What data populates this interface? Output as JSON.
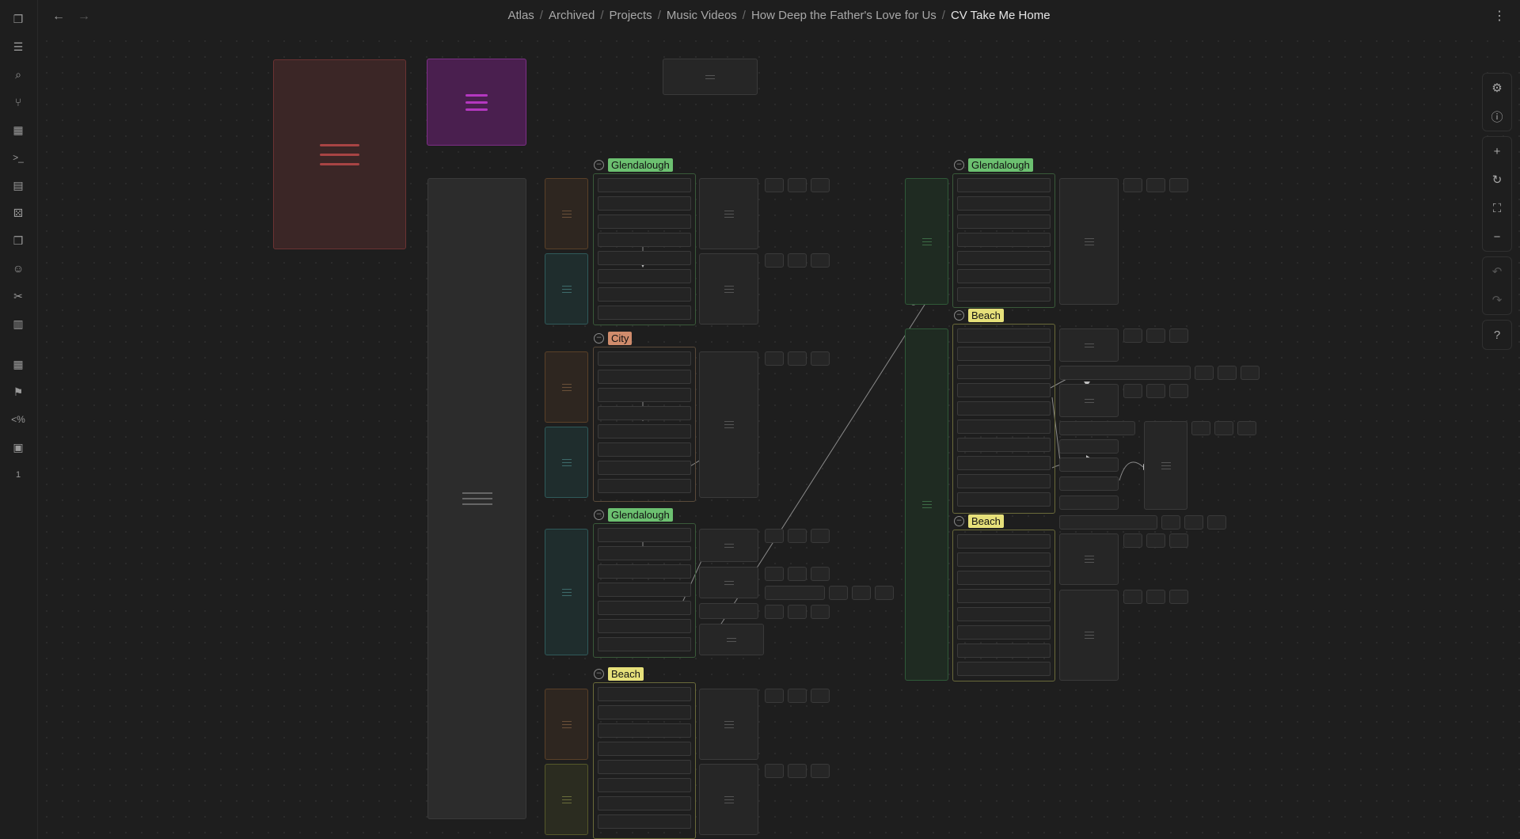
{
  "app": {
    "breadcrumb": [
      "Atlas",
      "Archived",
      "Projects",
      "Music Videos",
      "How Deep the Father's Love for Us",
      "CV Take Me Home"
    ],
    "separator": "/",
    "nav": {
      "back_icon": "arrow-left-icon",
      "forward_icon": "arrow-right-icon"
    },
    "more_icon": "more-vertical-icon"
  },
  "ribbon": {
    "icons": [
      "files-icon",
      "list-icon",
      "search-file-icon",
      "graph-icon",
      "grid-icon",
      "terminal-icon",
      "layout-icon",
      "dice-icon",
      "book-open-icon",
      "smiley-icon",
      "tools-icon",
      "reading-icon",
      "calendar-range-icon",
      "flag-icon",
      "templater-icon",
      "calendar-icon",
      "calendar-day-icon"
    ],
    "glyphs": [
      "❐",
      "☰",
      "⌕",
      "⑂",
      "▦",
      ">_",
      "▤",
      "⚄",
      "❒",
      "☺",
      "✂",
      "▥",
      "▦",
      "⚑",
      "<%",
      "▣",
      "1"
    ]
  },
  "canvas_controls": {
    "settings": "gear-icon",
    "info": "info-icon",
    "zoom_in": "plus-icon",
    "reset": "refresh-icon",
    "fit": "fullscreen-icon",
    "zoom_out": "minus-icon",
    "undo": "undo-icon",
    "redo": "redo-icon",
    "help": "help-icon",
    "glyphs": {
      "settings": "⚙",
      "info": "ⓘ",
      "zoom_in": "+",
      "reset": "↻",
      "fit": "⛶",
      "zoom_out": "−",
      "undo": "↶",
      "redo": "↷",
      "help": "?"
    }
  },
  "groups": [
    {
      "label": "Glendalough",
      "color": "green"
    },
    {
      "label": "City",
      "color": "orange"
    },
    {
      "label": "Glendalough",
      "color": "green"
    },
    {
      "label": "Beach",
      "color": "yellow"
    },
    {
      "label": "Glendalough",
      "color": "green"
    },
    {
      "label": "Beach",
      "color": "yellow"
    },
    {
      "label": "Beach",
      "color": "yellow"
    }
  ],
  "collapse_glyph": "−",
  "colors": {
    "tag_green": "#6cc070",
    "tag_orange": "#d08c6c",
    "tag_yellow": "#e6e07a",
    "card_red": "#a84444",
    "card_purple": "#b437c0"
  }
}
